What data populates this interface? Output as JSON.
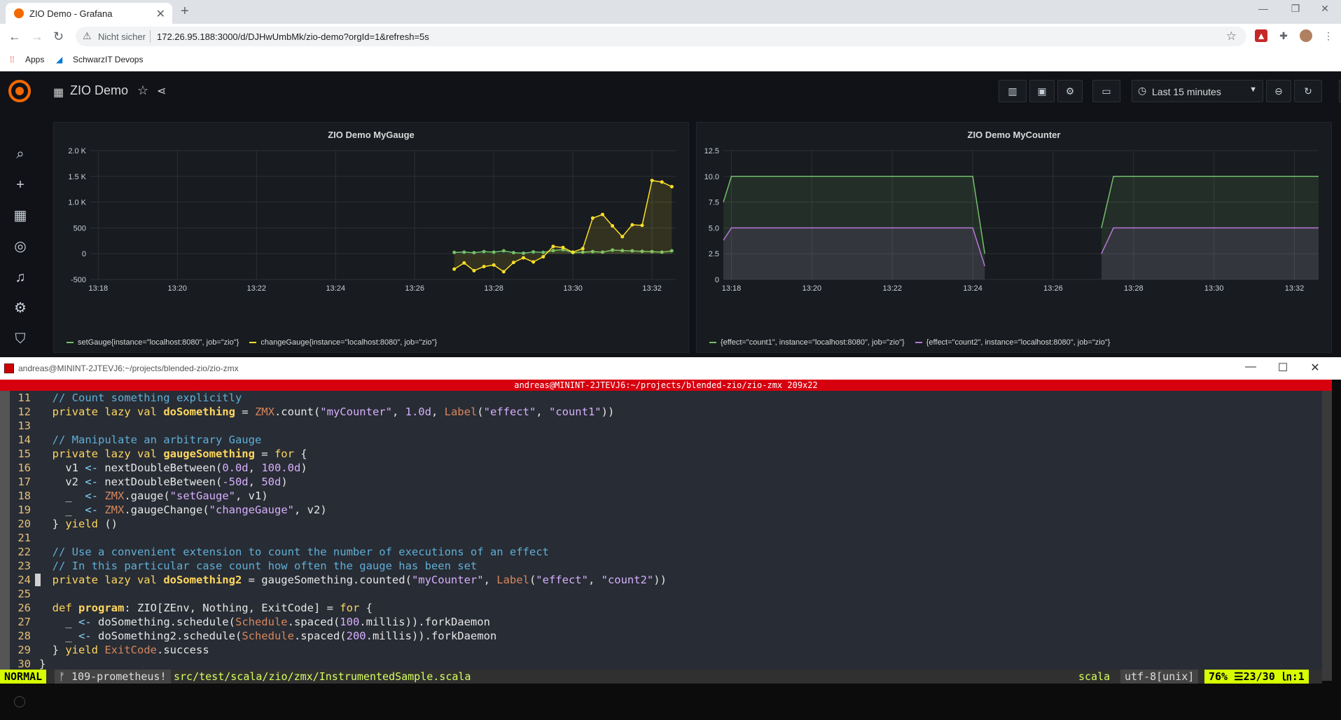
{
  "browser": {
    "tab_title": "ZIO Demo - Grafana",
    "close_glyph": "✕",
    "new_tab_glyph": "+",
    "insecure_label": "Nicht sicher",
    "url": "172.26.95.188:3000/d/DJHwUmbMk/zio-demo?orgId=1&refresh=5s",
    "bookmarks": {
      "apps": "Apps",
      "devops": "SchwarzIT Devops"
    }
  },
  "grafana": {
    "dashboard_title": "ZIO Demo",
    "time_range": "Last 15 minutes",
    "refresh_interval": "5s",
    "panels": [
      {
        "title": "ZIO Demo MyGauge",
        "legend": [
          {
            "label": "setGauge{instance=\"localhost:8080\", job=\"zio\"}",
            "color": "#73bf69"
          },
          {
            "label": "changeGauge{instance=\"localhost:8080\", job=\"zio\"}",
            "color": "#fade2a"
          }
        ]
      },
      {
        "title": "ZIO Demo MyCounter",
        "legend": [
          {
            "label": "{effect=\"count1\", instance=\"localhost:8080\", job=\"zio\"}",
            "color": "#73bf69"
          },
          {
            "label": "{effect=\"count2\", instance=\"localhost:8080\", job=\"zio\"}",
            "color": "#b877d9"
          }
        ]
      }
    ]
  },
  "chart_data": [
    {
      "type": "line",
      "title": "ZIO Demo MyGauge",
      "x_ticks": [
        "13:18",
        "13:20",
        "13:22",
        "13:24",
        "13:26",
        "13:28",
        "13:30",
        "13:32"
      ],
      "y_ticks": [
        "-500",
        "0",
        "500",
        "1.0 K",
        "1.5 K",
        "2.0 K"
      ],
      "ylim": [
        -500,
        2000
      ],
      "x_range_minutes": [
        17.8,
        32.6
      ],
      "series": [
        {
          "name": "setGauge{instance=\"localhost:8080\", job=\"zio\"}",
          "color": "#73bf69",
          "x": [
            27.0,
            27.25,
            27.5,
            27.75,
            28.0,
            28.25,
            28.5,
            28.75,
            29.0,
            29.25,
            29.5,
            29.75,
            30.0,
            30.25,
            30.5,
            30.75,
            31.0,
            31.25,
            31.5,
            31.75,
            32.0,
            32.25,
            32.5
          ],
          "y": [
            25,
            30,
            20,
            40,
            30,
            55,
            20,
            10,
            35,
            25,
            60,
            80,
            20,
            30,
            40,
            30,
            70,
            60,
            55,
            45,
            40,
            30,
            55
          ]
        },
        {
          "name": "changeGauge{instance=\"localhost:8080\", job=\"zio\"}",
          "color": "#fade2a",
          "x": [
            27.0,
            27.25,
            27.5,
            27.75,
            28.0,
            28.25,
            28.5,
            28.75,
            29.0,
            29.25,
            29.5,
            29.75,
            30.0,
            30.25,
            30.5,
            30.75,
            31.0,
            31.25,
            31.5,
            31.75,
            32.0,
            32.25,
            32.5
          ],
          "y": [
            -300,
            -180,
            -330,
            -250,
            -220,
            -350,
            -170,
            -80,
            -160,
            -60,
            140,
            120,
            30,
            100,
            690,
            760,
            540,
            330,
            560,
            550,
            1420,
            1390,
            1300
          ]
        }
      ]
    },
    {
      "type": "area",
      "title": "ZIO Demo MyCounter",
      "x_ticks": [
        "13:18",
        "13:20",
        "13:22",
        "13:24",
        "13:26",
        "13:28",
        "13:30",
        "13:32"
      ],
      "y_ticks": [
        "0",
        "2.5",
        "5.0",
        "7.5",
        "10.0",
        "12.5"
      ],
      "ylim": [
        0,
        12.5
      ],
      "x_range_minutes": [
        17.8,
        32.6
      ],
      "series": [
        {
          "name": "{effect=\"count1\", instance=\"localhost:8080\", job=\"zio\"}",
          "color": "#73bf69",
          "segments": [
            {
              "x": [
                17.8,
                18.0,
                24.0,
                24.3
              ],
              "y": [
                7.5,
                10.0,
                10.0,
                2.5
              ]
            },
            {
              "x": [
                27.2,
                27.5,
                32.6
              ],
              "y": [
                5.0,
                10.0,
                10.0
              ]
            }
          ]
        },
        {
          "name": "{effect=\"count2\", instance=\"localhost:8080\", job=\"zio\"}",
          "color": "#b877d9",
          "segments": [
            {
              "x": [
                17.8,
                18.0,
                24.0,
                24.3
              ],
              "y": [
                3.8,
                5.0,
                5.0,
                1.3
              ]
            },
            {
              "x": [
                27.2,
                27.5,
                32.6
              ],
              "y": [
                2.5,
                5.0,
                5.0
              ]
            }
          ]
        }
      ]
    }
  ],
  "terminal": {
    "window_title": "andreas@MININT-2JTEVJ6:~/projects/blended-zio/zio-zmx",
    "tmux_title": "andreas@MININT-2JTEVJ6:~/projects/blended-zio/zio-zmx 209x22",
    "lines": [
      {
        "num": "11",
        "tokens": [
          [
            "cm",
            "  // Count something explicitly"
          ]
        ]
      },
      {
        "num": "12",
        "tokens": [
          [
            "kw",
            "  private lazy val "
          ],
          [
            "fn",
            "doSomething"
          ],
          [
            "pl",
            " = "
          ],
          [
            "ty",
            "ZMX"
          ],
          [
            "pl",
            ".count("
          ],
          [
            "str",
            "\"myCounter\""
          ],
          [
            "pl",
            ", "
          ],
          [
            "str",
            "1.0d"
          ],
          [
            "pl",
            ", "
          ],
          [
            "ty",
            "Label"
          ],
          [
            "pl",
            "("
          ],
          [
            "str",
            "\"effect\""
          ],
          [
            "pl",
            ", "
          ],
          [
            "str",
            "\"count1\""
          ],
          [
            "pl",
            "))"
          ]
        ]
      },
      {
        "num": "13",
        "tokens": [
          [
            "pl",
            ""
          ]
        ]
      },
      {
        "num": "14",
        "tokens": [
          [
            "cm",
            "  // Manipulate an arbitrary Gauge"
          ]
        ]
      },
      {
        "num": "15",
        "tokens": [
          [
            "kw",
            "  private lazy val "
          ],
          [
            "fn",
            "gaugeSomething"
          ],
          [
            "pl",
            " = "
          ],
          [
            "kw",
            "for"
          ],
          [
            "pl",
            " {"
          ]
        ]
      },
      {
        "num": "16",
        "tokens": [
          [
            "pl",
            "    v1 "
          ],
          [
            "op",
            "<-"
          ],
          [
            "pl",
            " nextDoubleBetween("
          ],
          [
            "str",
            "0.0d"
          ],
          [
            "pl",
            ", "
          ],
          [
            "str",
            "100.0d"
          ],
          [
            "pl",
            ")"
          ]
        ]
      },
      {
        "num": "17",
        "tokens": [
          [
            "pl",
            "    v2 "
          ],
          [
            "op",
            "<-"
          ],
          [
            "pl",
            " nextDoubleBetween("
          ],
          [
            "str",
            "-50d"
          ],
          [
            "pl",
            ", "
          ],
          [
            "str",
            "50d"
          ],
          [
            "pl",
            ")"
          ]
        ]
      },
      {
        "num": "18",
        "tokens": [
          [
            "pl",
            "    _  "
          ],
          [
            "op",
            "<-"
          ],
          [
            "pl",
            " "
          ],
          [
            "ty",
            "ZMX"
          ],
          [
            "pl",
            ".gauge("
          ],
          [
            "str",
            "\"setGauge\""
          ],
          [
            "pl",
            ", v1)"
          ]
        ]
      },
      {
        "num": "19",
        "tokens": [
          [
            "pl",
            "    _  "
          ],
          [
            "op",
            "<-"
          ],
          [
            "pl",
            " "
          ],
          [
            "ty",
            "ZMX"
          ],
          [
            "pl",
            ".gaugeChange("
          ],
          [
            "str",
            "\"changeGauge\""
          ],
          [
            "pl",
            ", v2)"
          ]
        ]
      },
      {
        "num": "20",
        "tokens": [
          [
            "pl",
            "  } "
          ],
          [
            "kw",
            "yield"
          ],
          [
            "pl",
            " ()"
          ]
        ]
      },
      {
        "num": "21",
        "tokens": [
          [
            "pl",
            ""
          ]
        ]
      },
      {
        "num": "22",
        "tokens": [
          [
            "cm",
            "  // Use a convenient extension to count the number of executions of an effect"
          ]
        ]
      },
      {
        "num": "23",
        "tokens": [
          [
            "cm",
            "  // In this particular case count how often the gauge has been set"
          ]
        ]
      },
      {
        "num": "24",
        "tokens": [
          [
            "kw",
            "  private lazy val "
          ],
          [
            "fn",
            "doSomething2"
          ],
          [
            "pl",
            " = gaugeSomething.counted("
          ],
          [
            "str",
            "\"myCounter\""
          ],
          [
            "pl",
            ", "
          ],
          [
            "ty",
            "Label"
          ],
          [
            "pl",
            "("
          ],
          [
            "str",
            "\"effect\""
          ],
          [
            "pl",
            ", "
          ],
          [
            "str",
            "\"count2\""
          ],
          [
            "pl",
            "))"
          ]
        ]
      },
      {
        "num": "25",
        "tokens": [
          [
            "pl",
            ""
          ]
        ]
      },
      {
        "num": "26",
        "tokens": [
          [
            "kw",
            "  def "
          ],
          [
            "fn",
            "program"
          ],
          [
            "pl",
            ": ZIO[ZEnv, Nothing, ExitCode] = "
          ],
          [
            "kw",
            "for"
          ],
          [
            "pl",
            " {"
          ]
        ]
      },
      {
        "num": "27",
        "tokens": [
          [
            "pl",
            "    _ "
          ],
          [
            "op",
            "<-"
          ],
          [
            "pl",
            " doSomething.schedule("
          ],
          [
            "ty",
            "Schedule"
          ],
          [
            "pl",
            ".spaced("
          ],
          [
            "str",
            "100"
          ],
          [
            "pl",
            ".millis)).forkDaemon"
          ]
        ]
      },
      {
        "num": "28",
        "tokens": [
          [
            "pl",
            "    _ "
          ],
          [
            "op",
            "<-"
          ],
          [
            "pl",
            " doSomething2.schedule("
          ],
          [
            "ty",
            "Schedule"
          ],
          [
            "pl",
            ".spaced("
          ],
          [
            "str",
            "200"
          ],
          [
            "pl",
            ".millis)).forkDaemon"
          ]
        ]
      },
      {
        "num": "29",
        "tokens": [
          [
            "pl",
            "  } "
          ],
          [
            "kw",
            "yield"
          ],
          [
            "pl",
            " "
          ],
          [
            "ty",
            "ExitCode"
          ],
          [
            "pl",
            ".success"
          ]
        ]
      },
      {
        "num": "30",
        "tokens": [
          [
            "pl",
            "}"
          ]
        ]
      }
    ],
    "status": {
      "mode": "NORMAL",
      "branch": "ᚠ 109-prometheus!",
      "file": "src/test/scala/zio/zmx/InstrumentedSample.scala",
      "filetype": "scala",
      "encoding": "utf-8[unix]",
      "position": "76% ☰23/30 ㏑:1"
    }
  },
  "colors": {
    "grafana_orange": "#f46800",
    "tmux_red": "#d7000f",
    "vim_mode": "#d7ff00"
  }
}
